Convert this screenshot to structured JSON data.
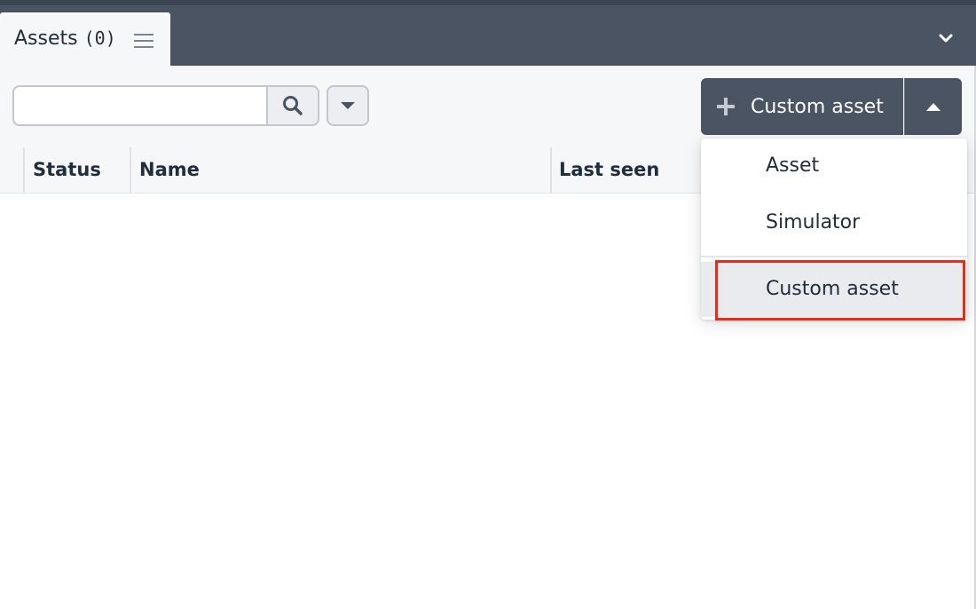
{
  "tab": {
    "label": "Assets",
    "count": "(0)"
  },
  "search": {
    "value": "",
    "placeholder": ""
  },
  "actions": {
    "split_label": "Custom asset"
  },
  "table": {
    "columns": [
      "Status",
      "Name",
      "Last seen"
    ],
    "rows": []
  },
  "dropdown": {
    "items": [
      "Asset",
      "Simulator",
      "Custom asset"
    ],
    "selected": "Custom asset"
  },
  "icons": {
    "tab_menu": "hamburger-icon",
    "collapse": "chevron-down-icon",
    "search": "search-icon",
    "filter": "caret-down-icon",
    "add": "plus-icon",
    "toggle": "caret-up-icon"
  },
  "colors": {
    "header_bg": "#4a5463",
    "highlight_border": "#ee2a14",
    "text": "#1f2d3d"
  }
}
